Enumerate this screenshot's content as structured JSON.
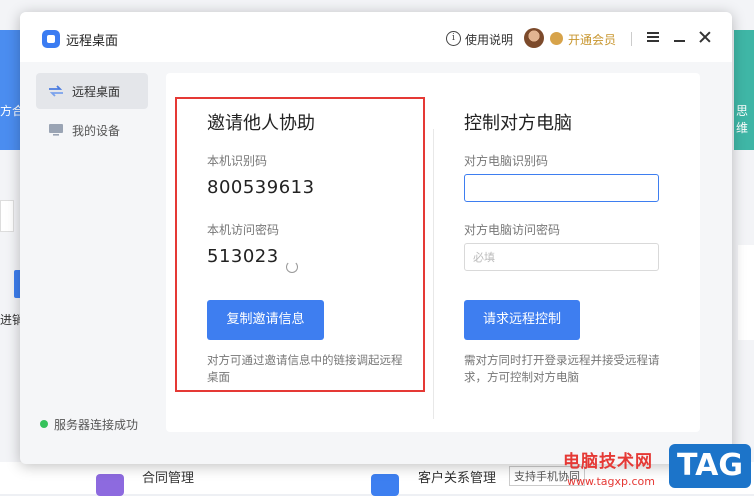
{
  "background": {
    "left_banner_text": "方合",
    "right_banner_text": "思维",
    "left_item_text": "进销",
    "bottom_item1": "合同管理",
    "bottom_item2": "客户关系管理",
    "bottom_tag": "支持手机协同"
  },
  "window": {
    "title": "远程桌面",
    "help_label": "使用说明",
    "vip_label": "开通会员"
  },
  "sidebar": {
    "items": [
      {
        "label": "远程桌面",
        "active": true
      },
      {
        "label": "我的设备",
        "active": false
      }
    ],
    "status": "服务器连接成功"
  },
  "invite": {
    "heading": "邀请他人协助",
    "id_label": "本机识别码",
    "id_value": "800539613",
    "pwd_label": "本机访问密码",
    "pwd_value": "513023",
    "button": "复制邀请信息",
    "note": "对方可通过邀请信息中的链接调起远程桌面"
  },
  "control": {
    "heading": "控制对方电脑",
    "id_label": "对方电脑识别码",
    "id_value": "",
    "pwd_label": "对方电脑访问密码",
    "pwd_placeholder": "必填",
    "button": "请求远程控制",
    "note": "需对方同时打开登录远程并接受远程请求，方可控制对方电脑"
  },
  "watermark": {
    "text": "电脑技术网",
    "url": "www.tagxp.com",
    "logo": "TAG"
  },
  "colors": {
    "accent": "#3e7ef0",
    "highlight_box": "#e53935",
    "status_ok": "#36c25c",
    "vip": "#c8962f"
  }
}
